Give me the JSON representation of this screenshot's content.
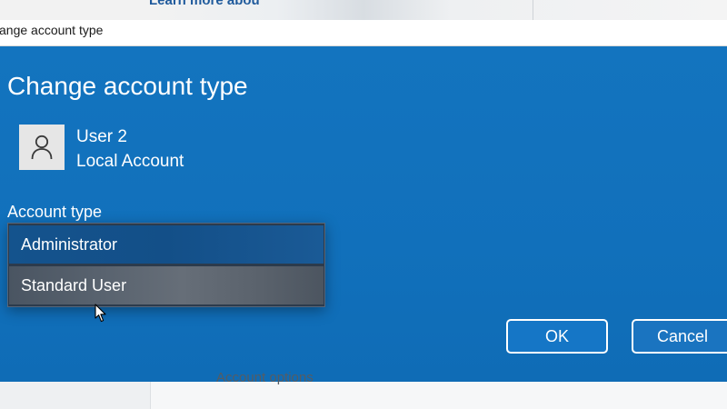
{
  "background": {
    "top_link": "Learn more abou",
    "bottom_text": "Account options"
  },
  "dialog": {
    "title": "ange account type",
    "heading": "Change account type",
    "user": {
      "name": "User 2",
      "type": "Local Account",
      "avatar_icon": "user-icon"
    },
    "account_type_label": "Account type",
    "dropdown": {
      "options": [
        "Administrator",
        "Standard User"
      ],
      "selected": "Administrator",
      "hovered": "Standard User"
    },
    "ok_label": "OK",
    "cancel_label": "Cancel"
  },
  "colors": {
    "dialog_blue": "#1374bf",
    "selected_option": "#14538d",
    "hovered_option": "#59636f"
  }
}
